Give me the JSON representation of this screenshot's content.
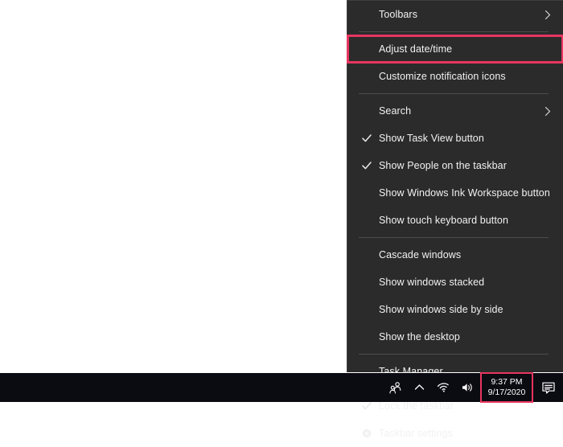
{
  "theme": {
    "menu_bg": "#2b2b2b",
    "menu_text": "#f2f2f2",
    "separator": "#4d4d4d",
    "highlight": "#e8355f",
    "taskbar_bg": "#0b0b12",
    "desktop_bg": "#ffffff"
  },
  "context_menu": {
    "name": "taskbar-context-menu",
    "groups": [
      {
        "items": [
          {
            "label": "Toolbars",
            "icon": "",
            "submenu": true,
            "checked": false,
            "highlighted": false,
            "name": "toolbars"
          }
        ]
      },
      {
        "items": [
          {
            "label": "Adjust date/time",
            "icon": "",
            "submenu": false,
            "checked": false,
            "highlighted": true,
            "name": "adjust-date-time"
          },
          {
            "label": "Customize notification icons",
            "icon": "",
            "submenu": false,
            "checked": false,
            "highlighted": false,
            "name": "customize-notification-icons"
          }
        ]
      },
      {
        "items": [
          {
            "label": "Search",
            "icon": "",
            "submenu": true,
            "checked": false,
            "highlighted": false,
            "name": "search"
          },
          {
            "label": "Show Task View button",
            "icon": "",
            "submenu": false,
            "checked": true,
            "highlighted": false,
            "name": "show-task-view-button"
          },
          {
            "label": "Show People on the taskbar",
            "icon": "",
            "submenu": false,
            "checked": true,
            "highlighted": false,
            "name": "show-people-on-the-taskbar"
          },
          {
            "label": "Show Windows Ink Workspace button",
            "icon": "",
            "submenu": false,
            "checked": false,
            "highlighted": false,
            "name": "show-windows-ink-workspace-button"
          },
          {
            "label": "Show touch keyboard button",
            "icon": "",
            "submenu": false,
            "checked": false,
            "highlighted": false,
            "name": "show-touch-keyboard-button"
          }
        ]
      },
      {
        "items": [
          {
            "label": "Cascade windows",
            "icon": "",
            "submenu": false,
            "checked": false,
            "highlighted": false,
            "name": "cascade-windows"
          },
          {
            "label": "Show windows stacked",
            "icon": "",
            "submenu": false,
            "checked": false,
            "highlighted": false,
            "name": "show-windows-stacked"
          },
          {
            "label": "Show windows side by side",
            "icon": "",
            "submenu": false,
            "checked": false,
            "highlighted": false,
            "name": "show-windows-side-by-side"
          },
          {
            "label": "Show the desktop",
            "icon": "",
            "submenu": false,
            "checked": false,
            "highlighted": false,
            "name": "show-the-desktop"
          }
        ]
      },
      {
        "items": [
          {
            "label": "Task Manager",
            "icon": "",
            "submenu": false,
            "checked": false,
            "highlighted": false,
            "name": "task-manager"
          }
        ]
      },
      {
        "items": [
          {
            "label": "Lock the taskbar",
            "icon": "",
            "submenu": false,
            "checked": true,
            "highlighted": false,
            "name": "lock-the-taskbar"
          },
          {
            "label": "Taskbar settings",
            "icon": "gear-icon",
            "submenu": false,
            "checked": false,
            "highlighted": false,
            "name": "taskbar-settings"
          }
        ]
      }
    ]
  },
  "taskbar": {
    "tray_icons": [
      {
        "name": "people-icon",
        "glyph": "people"
      },
      {
        "name": "show-hidden-icons-chevron-up-icon",
        "glyph": "chevron-up"
      },
      {
        "name": "network-wifi-icon",
        "glyph": "wifi"
      },
      {
        "name": "volume-speaker-icon",
        "glyph": "speaker"
      }
    ],
    "clock": {
      "name": "clock-date-time",
      "time": "9:37 PM",
      "date": "9/17/2020",
      "highlighted": true
    },
    "notifications": {
      "name": "action-center-icon",
      "glyph": "notification-bubble"
    }
  }
}
